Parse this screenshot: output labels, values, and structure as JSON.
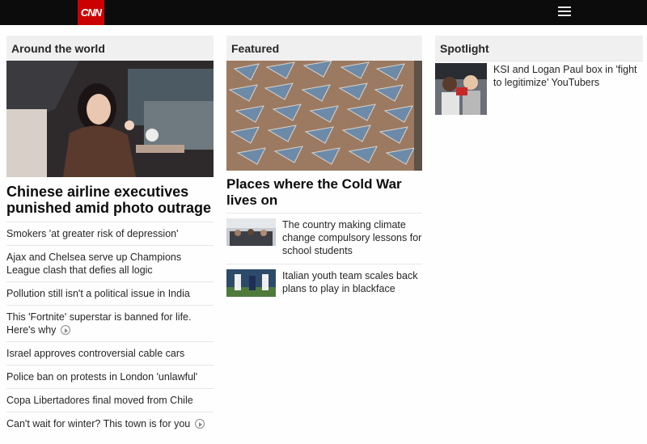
{
  "header": {
    "logo_text": "CNN",
    "menu_icon": "hamburger-menu-icon"
  },
  "around_the_world": {
    "heading": "Around the world",
    "hero_title": "Chinese airline executives punished amid photo outrage",
    "links": [
      {
        "text": "Smokers 'at greater risk of depression'",
        "video": false
      },
      {
        "text": "Ajax and Chelsea serve up Champions League clash that defies all logic",
        "video": false
      },
      {
        "text": "Pollution still isn't a political issue in India",
        "video": false
      },
      {
        "text": "This 'Fortnite' superstar is banned for life. Here's why",
        "video": true
      },
      {
        "text": "Israel approves controversial cable cars",
        "video": false
      },
      {
        "text": "Police ban on protests in London 'unlawful'",
        "video": false
      },
      {
        "text": "Copa Libertadores final moved from Chile",
        "video": false
      },
      {
        "text": "Can't wait for winter? This town is for you",
        "video": true
      }
    ]
  },
  "featured": {
    "heading": "Featured",
    "hero_title": "Places where the Cold War lives on",
    "items": [
      {
        "text": "The country making climate change compulsory lessons for school students"
      },
      {
        "text": "Italian youth team scales back plans to play in blackface"
      }
    ]
  },
  "spotlight": {
    "heading": "Spotlight",
    "items": [
      {
        "text": "KSI and Logan Paul box in 'fight to legitimize' YouTubers"
      }
    ]
  }
}
